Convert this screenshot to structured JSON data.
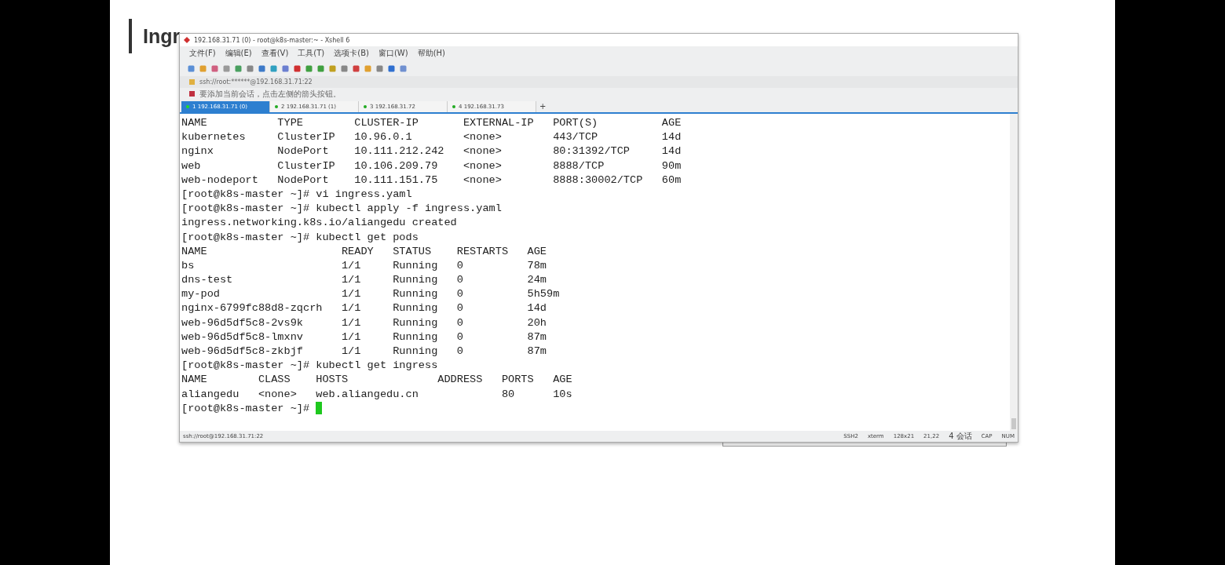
{
  "slide": {
    "title": "Ingr"
  },
  "window": {
    "title": "192.168.31.71 (0) - root@k8s-master:~ - Xshell 6"
  },
  "menu": [
    "文件(F)",
    "编辑(E)",
    "查看(V)",
    "工具(T)",
    "选项卡(B)",
    "窗口(W)",
    "帮助(H)"
  ],
  "address_bar": {
    "value": "ssh://root:******@192.168.31.71:22"
  },
  "hint_bar": {
    "text": "要添加当前会话，点击左侧的箭头按钮。"
  },
  "tabs": [
    {
      "label": "1 192.168.31.71 (0)",
      "selected": true
    },
    {
      "label": "2 192.168.31.71 (1)",
      "selected": false
    },
    {
      "label": "3 192.168.31.72",
      "selected": false
    },
    {
      "label": "4 192.168.31.73",
      "selected": false
    }
  ],
  "new_tab": "+",
  "terminal": {
    "lines": [
      "NAME           TYPE        CLUSTER-IP       EXTERNAL-IP   PORT(S)          AGE",
      "kubernetes     ClusterIP   10.96.0.1        <none>        443/TCP          14d",
      "nginx          NodePort    10.111.212.242   <none>        80:31392/TCP     14d",
      "web            ClusterIP   10.106.209.79    <none>        8888/TCP         90m",
      "web-nodeport   NodePort    10.111.151.75    <none>        8888:30002/TCP   60m",
      "[root@k8s-master ~]# vi ingress.yaml",
      "[root@k8s-master ~]# kubectl apply -f ingress.yaml",
      "ingress.networking.k8s.io/aliangedu created",
      "[root@k8s-master ~]# kubectl get pods",
      "NAME                     READY   STATUS    RESTARTS   AGE",
      "bs                       1/1     Running   0          78m",
      "dns-test                 1/1     Running   0          24m",
      "my-pod                   1/1     Running   0          5h59m",
      "nginx-6799fc88d8-zqcrh   1/1     Running   0          14d",
      "web-96d5df5c8-2vs9k      1/1     Running   0          20h",
      "web-96d5df5c8-lmxnv      1/1     Running   0          87m",
      "web-96d5df5c8-zkbjf      1/1     Running   0          87m",
      "[root@k8s-master ~]# kubectl get ingress",
      "NAME        CLASS    HOSTS              ADDRESS   PORTS   AGE",
      "aliangedu   <none>   web.aliangedu.cn             80      10s"
    ],
    "prompt": "[root@k8s-master ~]# "
  },
  "status_bar": {
    "left": "ssh://root@192.168.31.71:22",
    "items": [
      "SSH2",
      "xterm",
      "128x21",
      "21,22",
      "4 会话",
      "CAP",
      "NUM"
    ]
  }
}
